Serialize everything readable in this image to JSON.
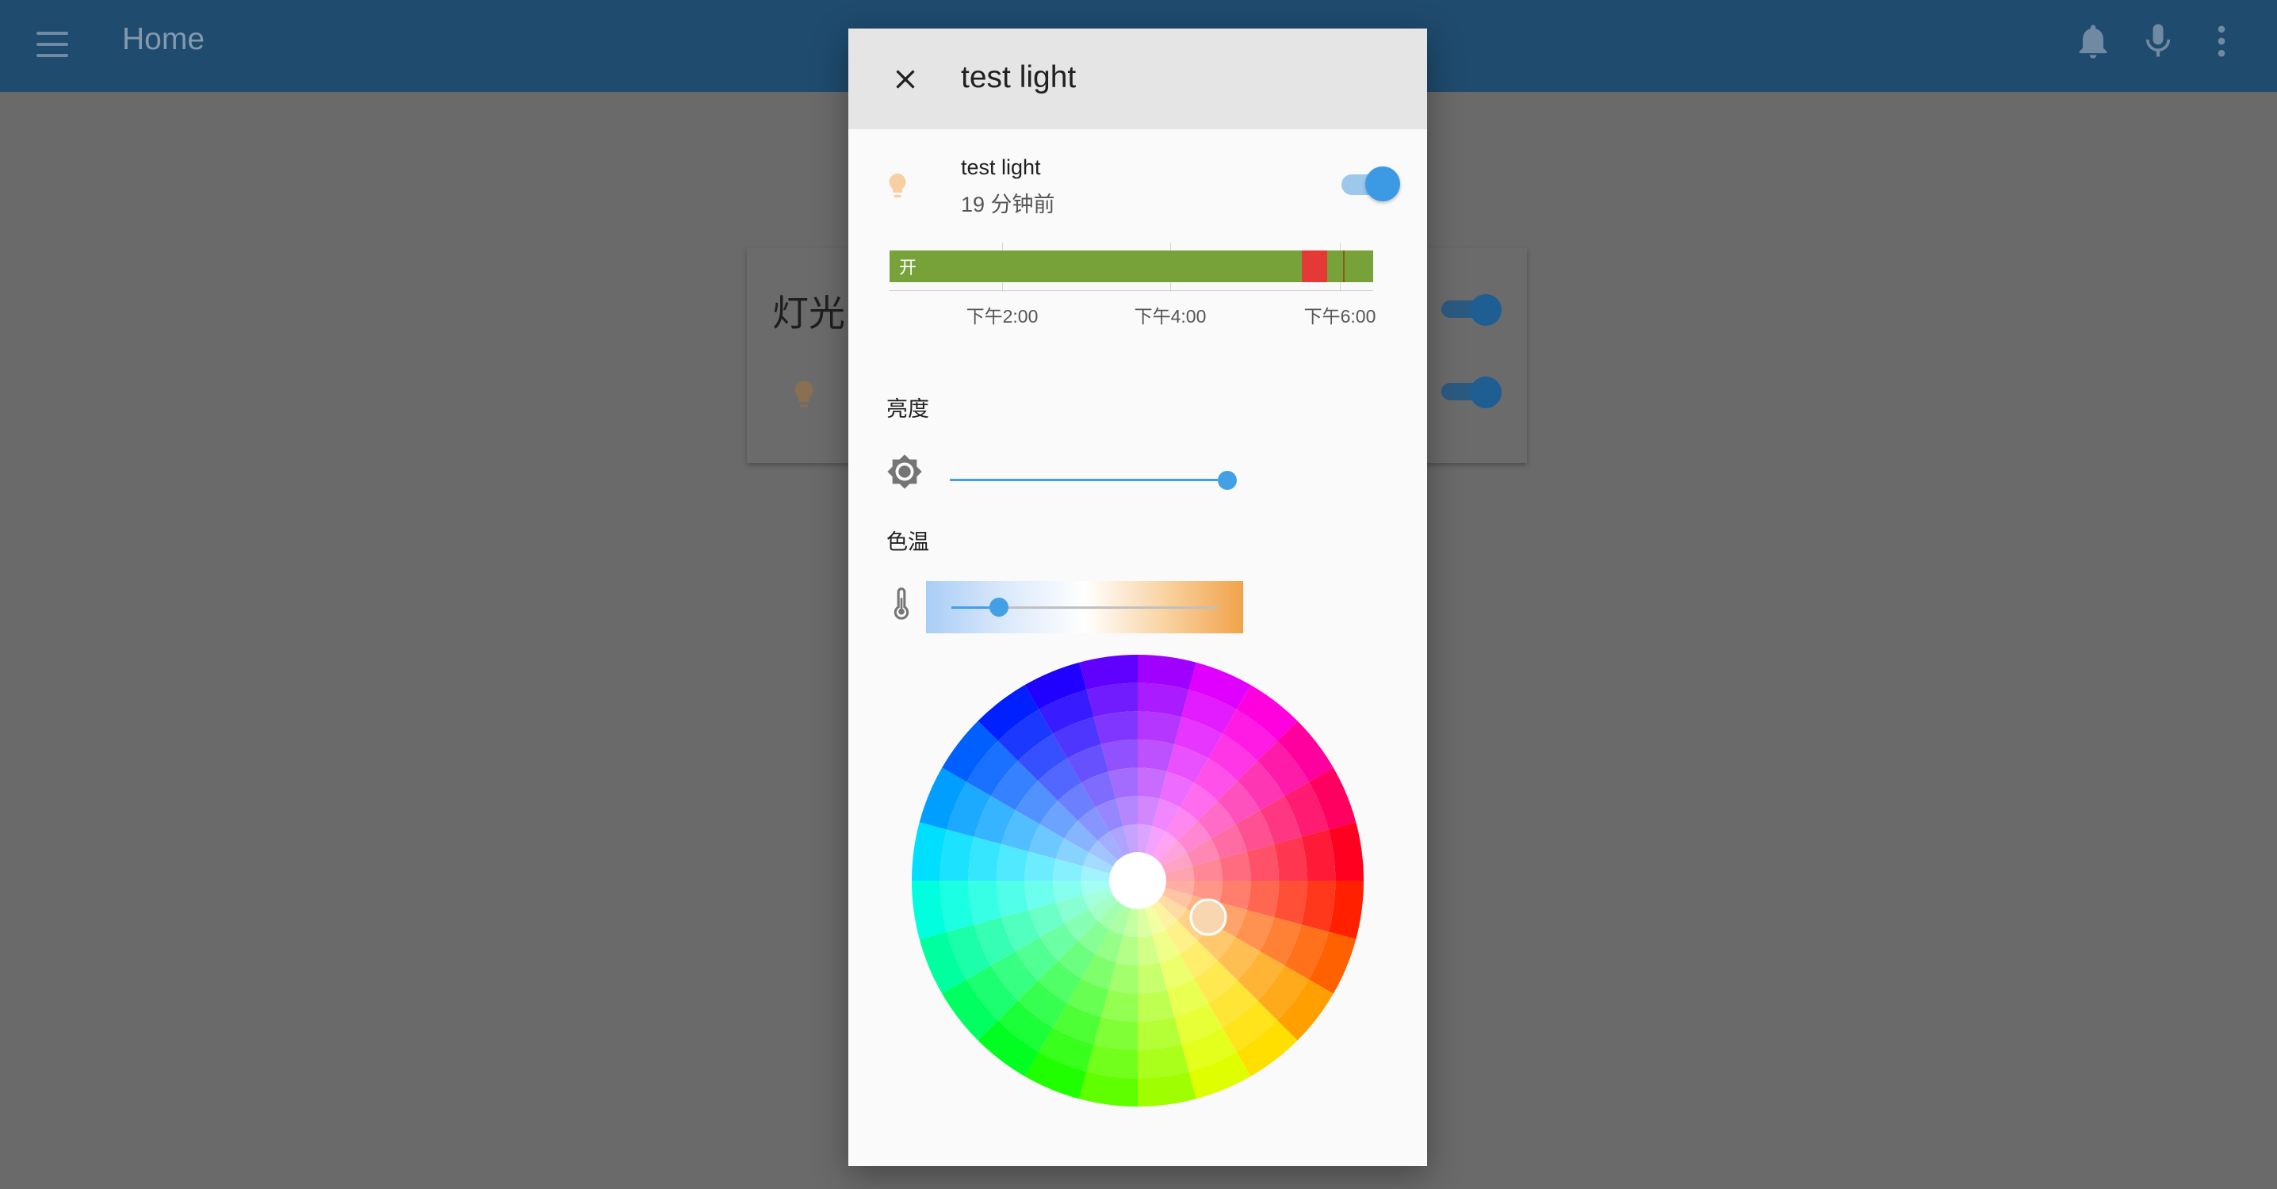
{
  "app_bar": {
    "title": "Home",
    "icons": [
      "menu-icon",
      "notifications-bell-icon",
      "microphone-icon",
      "more-vert-icon"
    ]
  },
  "card": {
    "title": "灯光",
    "entity_icon": "lightbulb-icon"
  },
  "dialog": {
    "title": "test light",
    "close_icon": "close-icon",
    "entity": {
      "name": "test light",
      "last_changed": "19 分钟前",
      "icon": "lightbulb-icon",
      "state_on": true
    },
    "history": {
      "on_label": "开",
      "ticks": [
        "下午2:00",
        "下午4:00",
        "下午6:00"
      ],
      "colors": {
        "on": "#77a23a",
        "other": "#e53935"
      }
    },
    "brightness": {
      "label": "亮度",
      "icon": "brightness-icon",
      "value_fraction": 1.0
    },
    "color_temp": {
      "label": "色温",
      "icon": "thermometer-icon",
      "value_fraction": 0.18
    },
    "color_wheel": {
      "selected_color": "#f8d6b0"
    }
  },
  "colors": {
    "app_bar": "#1f4b6e",
    "accent": "#44a0e6",
    "overlay_bg": "#6a6a6a"
  }
}
